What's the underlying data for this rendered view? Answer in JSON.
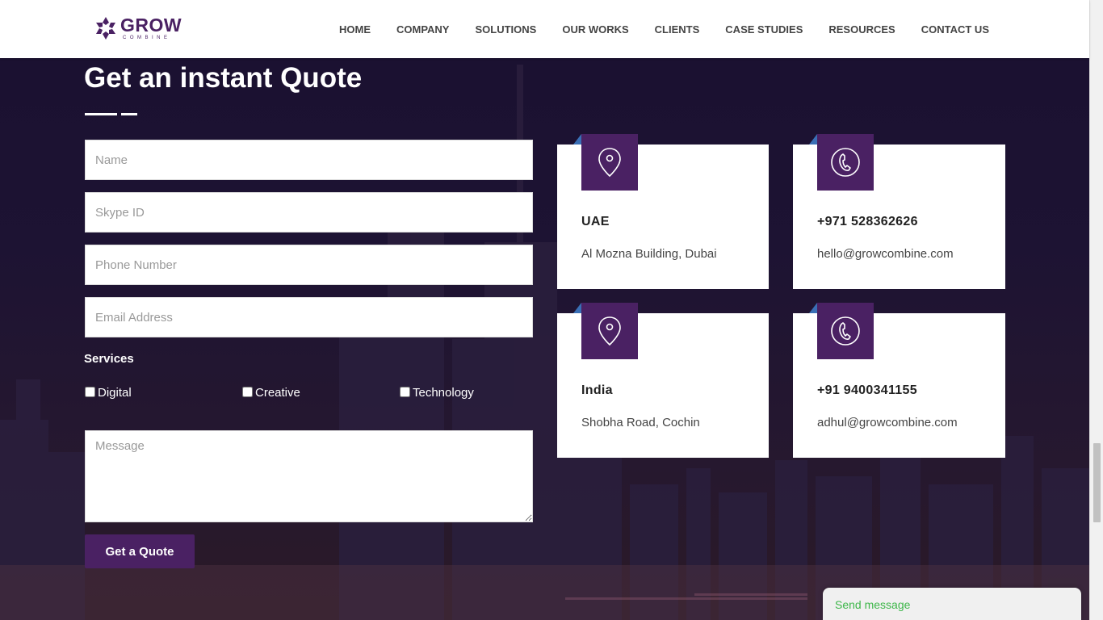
{
  "header": {
    "logo": {
      "word": "GROW",
      "sub": "COMBINE"
    },
    "nav": [
      "HOME",
      "COMPANY",
      "SOLUTIONS",
      "OUR WORKS",
      "CLIENTS",
      "CASE STUDIES",
      "RESOURCES",
      "CONTACT US"
    ]
  },
  "form": {
    "title": "Get an instant Quote",
    "name_placeholder": "Name",
    "skype_placeholder": "Skype ID",
    "phone_placeholder": "Phone Number",
    "email_placeholder": "Email Address",
    "services_label": "Services",
    "services": [
      "Digital",
      "Creative",
      "Technology"
    ],
    "message_placeholder": "Message",
    "submit_label": "Get a Quote"
  },
  "contacts": [
    {
      "icon": "location-pin-icon",
      "heading": "UAE",
      "text": "Al Mozna Building, Dubai"
    },
    {
      "icon": "phone-icon",
      "heading": "+971 528362626",
      "text": "hello@growcombine.com"
    },
    {
      "icon": "location-pin-icon",
      "heading": "India",
      "text": "Shobha Road, Cochin"
    },
    {
      "icon": "phone-icon",
      "heading": "+91 9400341155",
      "text": "adhul@growcombine.com"
    }
  ],
  "chat": {
    "label": "Send message"
  },
  "colors": {
    "brand": "#4a2163",
    "accent": "#3a6fb5",
    "chat_text": "#3eb74a"
  }
}
